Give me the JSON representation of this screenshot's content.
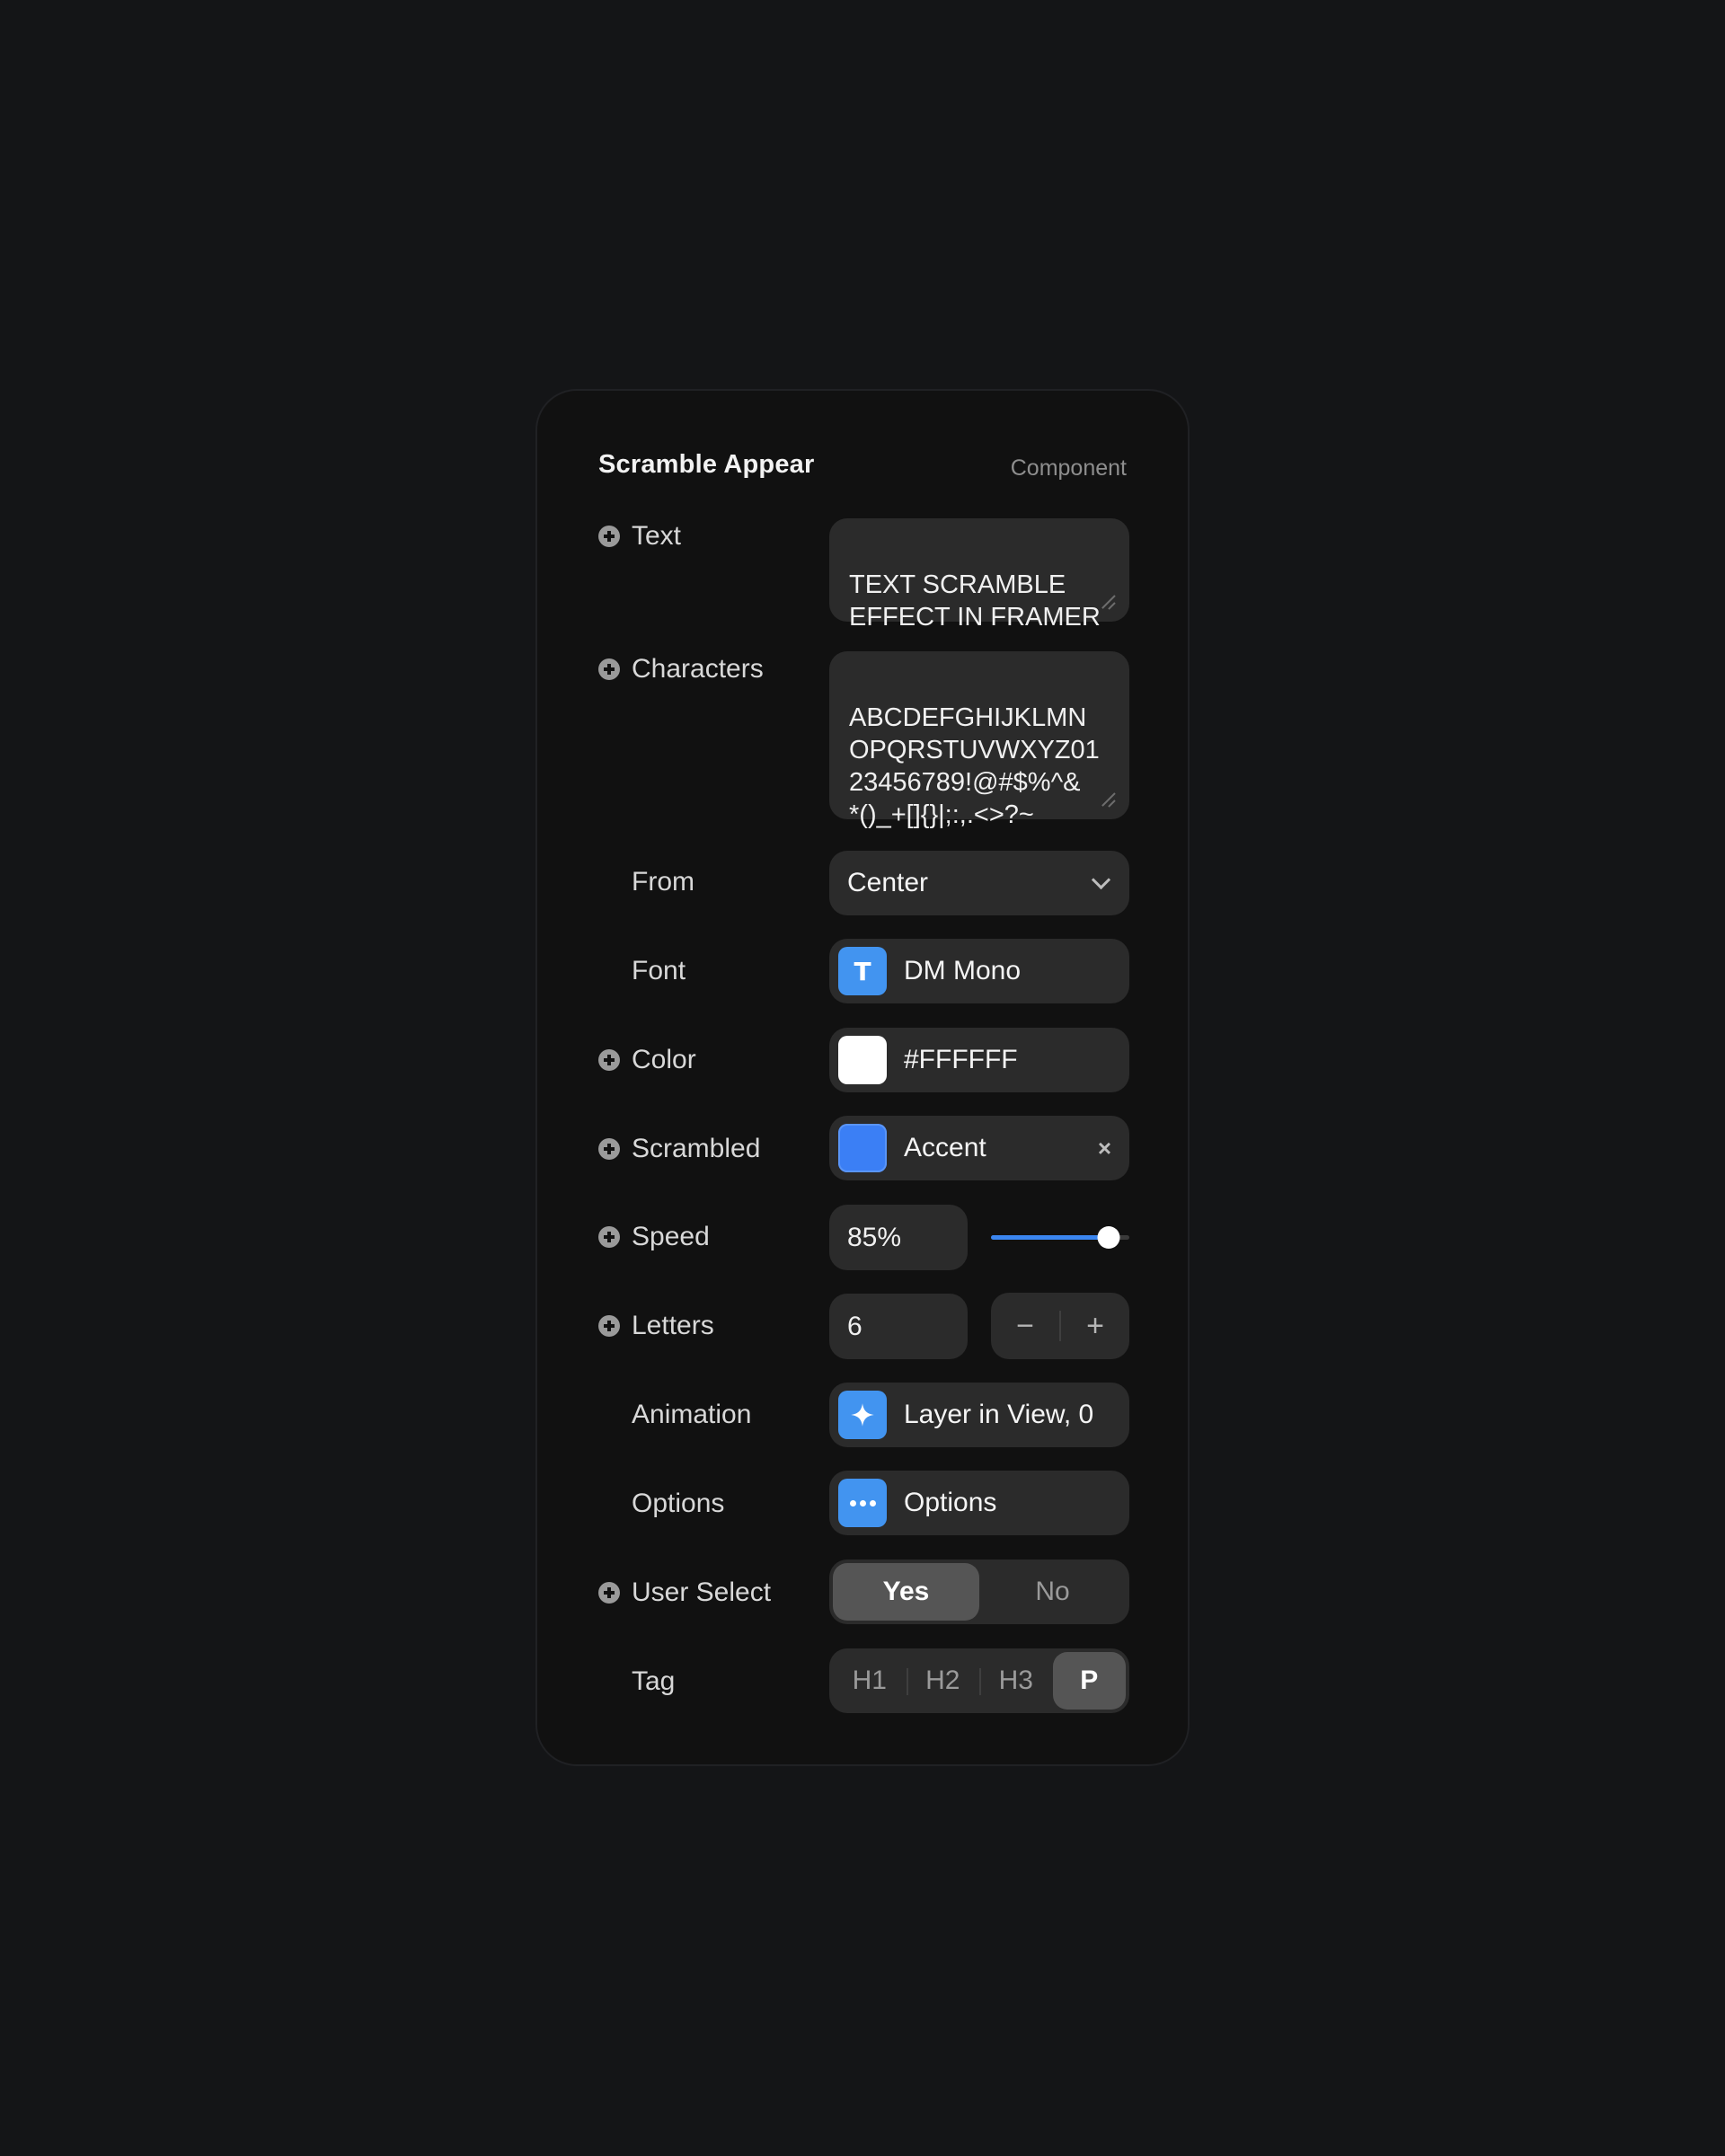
{
  "header": {
    "title": "Scramble Appear",
    "subtitle": "Component"
  },
  "colors": {
    "accent": "#3B7FF5",
    "icon_blue": "#4294F0",
    "page_bg": "#141517",
    "panel_bg": "#111111",
    "control_bg": "#2B2B2B"
  },
  "rows": {
    "text": {
      "label": "Text",
      "value": "TEXT SCRAMBLE\nEFFECT IN FRAMER"
    },
    "characters": {
      "label": "Characters",
      "value": "ABCDEFGHIJKLMN\nOPQRSTUVWXYZ01\n23456789!@#$%^&\n*()_+[]{}|;:,.<>?~"
    },
    "from": {
      "label": "From",
      "value": "Center"
    },
    "font": {
      "label": "Font",
      "value": "DM Mono",
      "icon": "T"
    },
    "color": {
      "label": "Color",
      "value": "#FFFFFF",
      "swatch": "#FFFFFF"
    },
    "scrambled": {
      "label": "Scrambled",
      "value": "Accent",
      "swatch": "#3B7FF5",
      "clear": "×"
    },
    "speed": {
      "label": "Speed",
      "value": "85%",
      "percent": 85
    },
    "letters": {
      "label": "Letters",
      "value": "6",
      "decrement": "−",
      "increment": "+"
    },
    "animation": {
      "label": "Animation",
      "value": "Layer in View, 0"
    },
    "options": {
      "label": "Options",
      "value": "Options"
    },
    "user_select": {
      "label": "User Select",
      "options": [
        "Yes",
        "No"
      ],
      "selected": "Yes"
    },
    "tag": {
      "label": "Tag",
      "options": [
        "H1",
        "H2",
        "H3",
        "P"
      ],
      "selected": "P"
    }
  }
}
